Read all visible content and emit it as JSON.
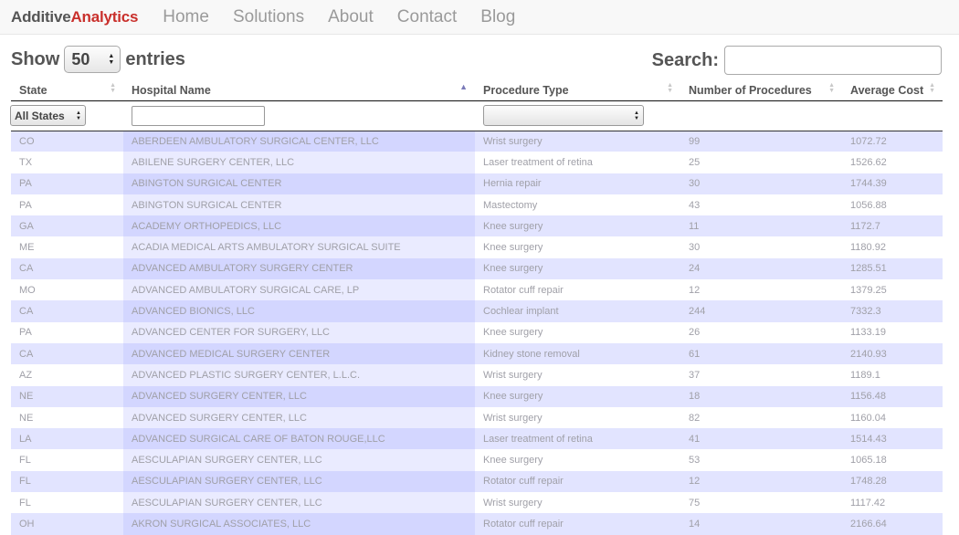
{
  "brand": {
    "part1": "Additive",
    "part2": "Analytics"
  },
  "nav": [
    "Home",
    "Solutions",
    "About",
    "Contact",
    "Blog"
  ],
  "controls": {
    "show_label": "Show",
    "entries_value": "50",
    "entries_label": "entries",
    "search_label": "Search:",
    "search_value": ""
  },
  "columns": [
    "State",
    "Hospital Name",
    "Procedure Type",
    "Number of Procedures",
    "Average Cost"
  ],
  "filters": {
    "state_value": "All States",
    "hospital_value": "",
    "procedure_value": ""
  },
  "colors": {
    "odd_row": "#e2e4ff",
    "sorted_odd": "#d3d6ff",
    "brand_red": "#c9302c"
  },
  "rows": [
    [
      "CO",
      "ABERDEEN AMBULATORY SURGICAL CENTER, LLC",
      "Wrist surgery",
      "99",
      "1072.72"
    ],
    [
      "TX",
      "ABILENE SURGERY CENTER, LLC",
      "Laser treatment of retina",
      "25",
      "1526.62"
    ],
    [
      "PA",
      "ABINGTON SURGICAL CENTER",
      "Hernia repair",
      "30",
      "1744.39"
    ],
    [
      "PA",
      "ABINGTON SURGICAL CENTER",
      "Mastectomy",
      "43",
      "1056.88"
    ],
    [
      "GA",
      "ACADEMY ORTHOPEDICS, LLC",
      "Knee surgery",
      "11",
      "1172.7"
    ],
    [
      "ME",
      "ACADIA MEDICAL ARTS AMBULATORY SURGICAL SUITE",
      "Knee surgery",
      "30",
      "1180.92"
    ],
    [
      "CA",
      "ADVANCED AMBULATORY SURGERY CENTER",
      "Knee surgery",
      "24",
      "1285.51"
    ],
    [
      "MO",
      "ADVANCED AMBULATORY SURGICAL CARE, LP",
      "Rotator cuff repair",
      "12",
      "1379.25"
    ],
    [
      "CA",
      "ADVANCED BIONICS, LLC",
      "Cochlear implant",
      "244",
      "7332.3"
    ],
    [
      "PA",
      "ADVANCED CENTER FOR SURGERY, LLC",
      "Knee surgery",
      "26",
      "1133.19"
    ],
    [
      "CA",
      "ADVANCED MEDICAL SURGERY CENTER",
      "Kidney stone removal",
      "61",
      "2140.93"
    ],
    [
      "AZ",
      "ADVANCED PLASTIC SURGERY CENTER, L.L.C.",
      "Wrist surgery",
      "37",
      "1189.1"
    ],
    [
      "NE",
      "ADVANCED SURGERY CENTER, LLC",
      "Knee surgery",
      "18",
      "1156.48"
    ],
    [
      "NE",
      "ADVANCED SURGERY CENTER, LLC",
      "Wrist surgery",
      "82",
      "1160.04"
    ],
    [
      "LA",
      "ADVANCED SURGICAL CARE OF BATON ROUGE,LLC",
      "Laser treatment of retina",
      "41",
      "1514.43"
    ],
    [
      "FL",
      "AESCULAPIAN SURGERY CENTER, LLC",
      "Knee surgery",
      "53",
      "1065.18"
    ],
    [
      "FL",
      "AESCULAPIAN SURGERY CENTER, LLC",
      "Rotator cuff repair",
      "12",
      "1748.28"
    ],
    [
      "FL",
      "AESCULAPIAN SURGERY CENTER, LLC",
      "Wrist surgery",
      "75",
      "1117.42"
    ],
    [
      "OH",
      "AKRON SURGICAL ASSOCIATES, LLC",
      "Rotator cuff repair",
      "14",
      "2166.64"
    ]
  ]
}
